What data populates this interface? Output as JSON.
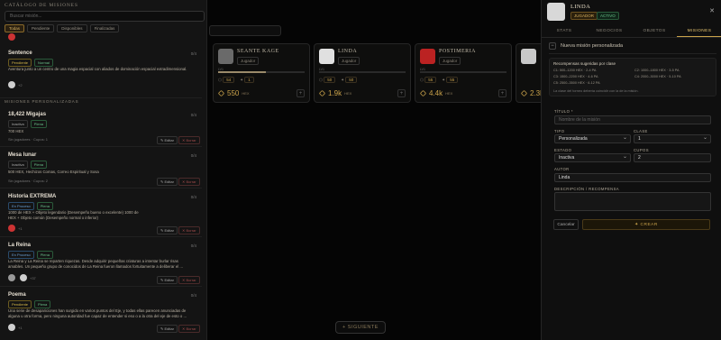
{
  "board": {
    "next_label": "+ SIGUIENTE",
    "players": [
      {
        "name": "SEANTE KAGE",
        "role": "Jugador",
        "xp_left": "LV1",
        "xp_right": "",
        "xp_fill": 0.55,
        "stats": [
          "54",
          "1"
        ],
        "gold": "550",
        "gold_unit": "HEX"
      },
      {
        "name": "LINDA",
        "role": "Jugador",
        "xp_left": "LV1",
        "xp_right": "",
        "xp_fill": 0.0,
        "stats": [
          "50",
          "50"
        ],
        "gold": "1.9k",
        "gold_unit": "HEX"
      },
      {
        "name": "POSTIMERIA",
        "role": "Jugador",
        "xp_left": "LV1",
        "xp_right": "",
        "xp_fill": 0.0,
        "stats": [
          "55",
          "55"
        ],
        "gold": "4.4k",
        "gold_unit": "HEX"
      },
      {
        "name": "",
        "role": "Jugador",
        "xp_left": "LV1",
        "xp_right": "",
        "xp_fill": 0.0,
        "stats": [
          "",
          ""
        ],
        "gold": "2.3k",
        "gold_unit": ""
      }
    ]
  },
  "catalog": {
    "title": "CATÁLOGO DE MISIONES",
    "search_placeholder": "Buscar misión...",
    "filters": [
      "Todas",
      "Pendiente",
      "Disponibles",
      "Finalizadas"
    ],
    "section_custom": "MISIONES PERSONALIZADAS",
    "top_quest": {
      "name": "Sentence",
      "slots": "0/4",
      "tags": [
        "Pendiente",
        "Normal"
      ],
      "desc": "Aventura junto a un centro de una magia espacial con aliados de dominación espacial extradimensional.",
      "players": "+2"
    },
    "quests": [
      {
        "name": "18,422 Migajas",
        "slots": "0/4",
        "tags": [
          "Inactiva",
          "Plena"
        ],
        "desc": "700 HEX",
        "players": "Sin jugadores · Cupos: 1",
        "edit": "✎ Editar",
        "del": "✕ Borrar"
      },
      {
        "name": "Mesa lunar",
        "slots": "0/4",
        "tags": [
          "Inactiva",
          "Plena"
        ],
        "desc": "500 HEX, Hechizos Comas, Correo Espiritual y Sosa",
        "players": "Sin jugadores · Cupos: 2",
        "edit": "✎ Editar",
        "del": "✕ Borrar"
      },
      {
        "name": "Historia EXTREMA",
        "slots": "0/4",
        "tags": [
          "En Proceso",
          "Plena"
        ],
        "desc": "1000 de HEX + Objeto legendario (Desempeño bueno o excelente) 1000 de HEX + Objeto común (Desempeño normal o inferior)",
        "players": "+1",
        "edit": "✎ Editar",
        "del": "✕ Borrar"
      },
      {
        "name": "La Reina",
        "slots": "0/4",
        "tags": [
          "En Proceso",
          "Plena"
        ],
        "desc": "La Reina y La Reina se reparten riquezas. Desde adquirir pequeñas criaturas a intentar burlar risas amables. Un pequeño grupo de conocidos de La Reina fueron llamados fortuitamente a deliberar el ...",
        "players": "+37",
        "edit": "✎ Editar",
        "del": "✕ Borrar"
      },
      {
        "name": "Poema",
        "slots": "0/4",
        "tags": [
          "Pendiente",
          "Plena"
        ],
        "desc": "Una serie de desapariciones han surgido en varios puntos del Eje, y todas ellas parecen anunciadas de alguna u otra forma, pero ninguna autoridad fue capaz de entender si eso o a la otra del eje de esto o ...",
        "players": "+1",
        "edit": "✎ Editar",
        "del": "✕ Borrar"
      }
    ]
  },
  "panel": {
    "name": "LINDA",
    "role_badge": "JUGADOR",
    "state_badge": "ACTIVO",
    "close": "✕",
    "tabs": [
      "STATS",
      "NEGOCIOS",
      "OBJETOS",
      "MISIONES"
    ],
    "subheader": "Nueva misión personalizada",
    "reco": {
      "title": "Recompensas sugeridas por clase",
      "c1": "C1: 500–1200 HEX · 2-4 PA",
      "c2": "C2: 1000–1800 HEX · 3-5 PA",
      "c3": "C3: 1500–2200 HEX · 4-6 PA",
      "c4": "C4: 2000–3000 HEX · 5-10 PA",
      "c5": "C5: 2500–3500 HEX · 6-12 PA",
      "note": "La clase del torneo debería coincidir con la de la misión."
    },
    "form": {
      "title_label": "TÍTULO *",
      "title_placeholder": "Nombre de la misión",
      "type_label": "TIPO",
      "type_value": "Personalizada",
      "class_label": "CLASE",
      "class_value": "1",
      "state_label": "ESTADO",
      "state_value": "Inactiva",
      "slots_label": "CUPOS",
      "slots_value": "2",
      "author_label": "AUTOR",
      "author_value": "Linda",
      "desc_label": "DESCRIPCIÓN / RECOMPENSA",
      "cancel": "Cancelar",
      "create": "✦ CREAR"
    }
  }
}
